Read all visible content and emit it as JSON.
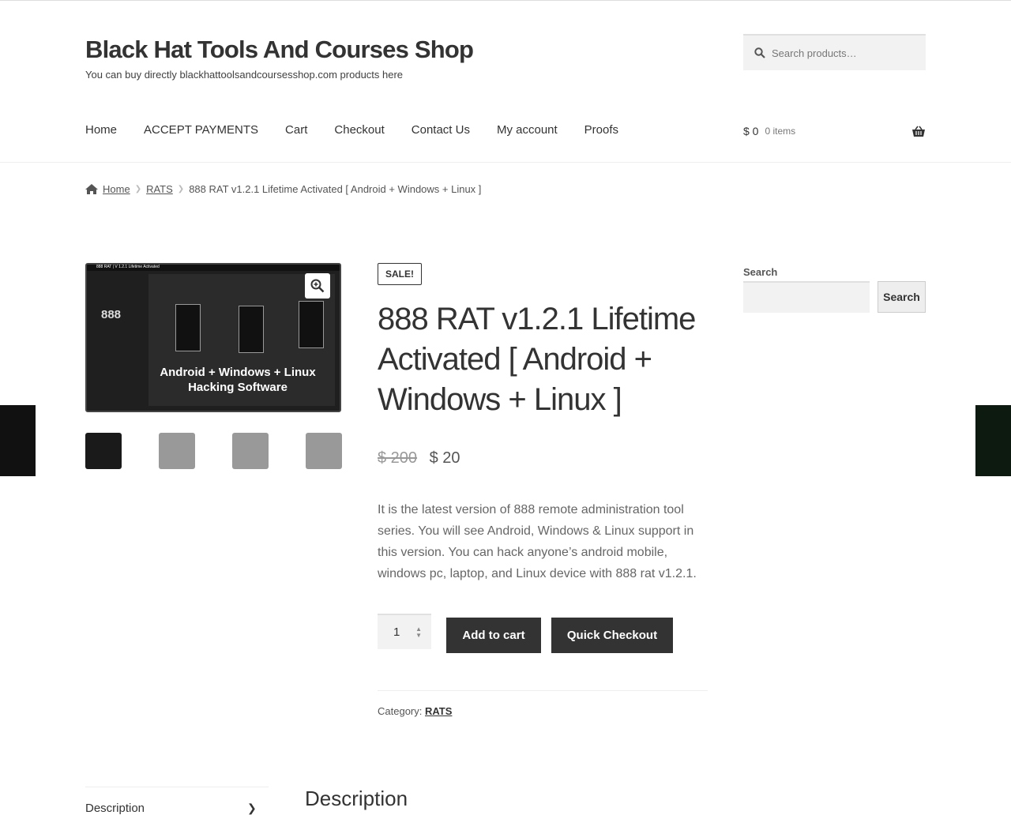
{
  "site": {
    "title": "Black Hat Tools And Courses Shop",
    "tagline": "You can buy directly blackhattoolsandcoursesshop.com products here"
  },
  "search": {
    "placeholder": "Search products…"
  },
  "nav": [
    "Home",
    "ACCEPT PAYMENTS",
    "Cart",
    "Checkout",
    "Contact Us",
    "My account",
    "Proofs"
  ],
  "cart": {
    "amount": "$ 0",
    "count": "0 items"
  },
  "breadcrumb": {
    "home": "Home",
    "category": "RATS",
    "current": "888 RAT v1.2.1 Lifetime Activated [ Android + Windows + Linux ]"
  },
  "product": {
    "image_caption": "Android + Windows + Linux Hacking Software",
    "image_title": "888 RAT | V 1.2.1 Lifetime Activated",
    "image_logo": "888",
    "sale_badge": "SALE!",
    "title": "888 RAT v1.2.1 Lifetime Activated [ Android + Windows + Linux ]",
    "old_price": "$ 200",
    "price": "$ 20",
    "description": "It is the latest version of 888 remote administration tool series. You will see Android, Windows & Linux support in this version. You can hack anyone’s android mobile, windows pc, laptop, and Linux device with 888 rat v1.2.1.",
    "quantity": "1",
    "add_to_cart": "Add to cart",
    "quick_checkout": "Quick Checkout",
    "category_label": "Category:",
    "category": "RATS"
  },
  "widget": {
    "label": "Search",
    "button": "Search"
  },
  "tabs": {
    "description_tab": "Description",
    "description_heading": "Description"
  }
}
